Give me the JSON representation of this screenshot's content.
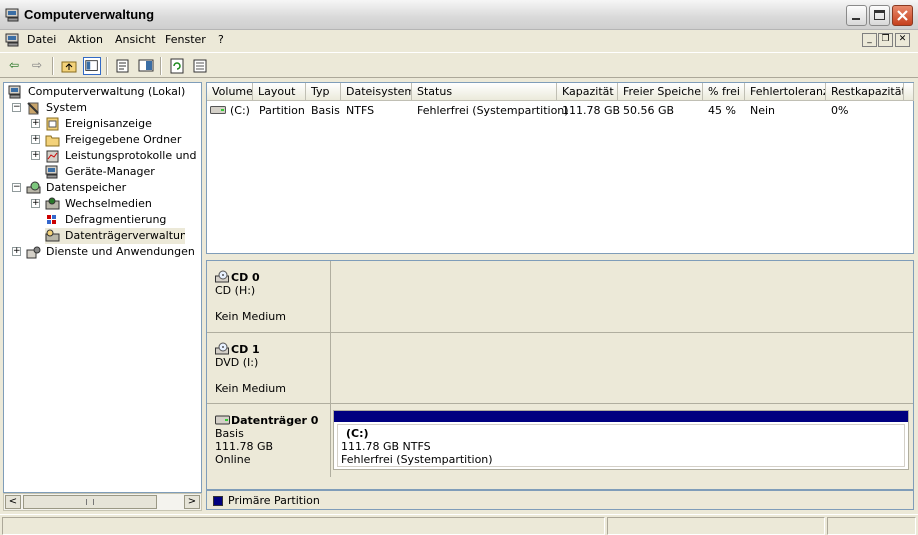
{
  "window": {
    "title": "Computerverwaltung"
  },
  "menubar": {
    "items": [
      "Datei",
      "Aktion",
      "Ansicht",
      "Fenster",
      "?"
    ]
  },
  "tree": {
    "root": "Computerverwaltung (Lokal)",
    "system": "System",
    "ereignisanzeige": "Ereignisanzeige",
    "freigegebene": "Freigegebene Ordner",
    "leistung": "Leistungsprotokolle und Warnungen",
    "geraete": "Geräte-Manager",
    "datenspeicher": "Datenspeicher",
    "wechselmedien": "Wechselmedien",
    "defrag": "Defragmentierung",
    "datentraeger": "Datenträgerverwaltung",
    "dienste": "Dienste und Anwendungen"
  },
  "volume_table": {
    "headers": [
      "Volume",
      "Layout",
      "Typ",
      "Dateisystem",
      "Status",
      "Kapazität",
      "Freier Speicher",
      "% frei",
      "Fehlertoleranz",
      "Restkapazität"
    ],
    "rows": [
      [
        "(C:)",
        "Partition",
        "Basis",
        "NTFS",
        "Fehlerfrei (Systempartition)",
        "111.78 GB",
        "50.56 GB",
        "45 %",
        "Nein",
        "0%"
      ]
    ]
  },
  "disks": {
    "cd0": {
      "name": "CD 0",
      "type": "CD (H:)",
      "status": "Kein Medium"
    },
    "cd1": {
      "name": "CD 1",
      "type": "DVD (I:)",
      "status": "Kein Medium"
    },
    "disk0": {
      "name": "Datenträger 0",
      "type": "Basis",
      "size": "111.78 GB",
      "status": "Online",
      "partition": {
        "label": "(C:)",
        "detail": "111.78 GB NTFS",
        "status": "Fehlerfrei (Systempartition)"
      }
    }
  },
  "legend": {
    "label": "Primäre Partition",
    "color": "#000080"
  },
  "colors": {
    "partition_bar": "#000080",
    "selection": "#ece9d8"
  }
}
